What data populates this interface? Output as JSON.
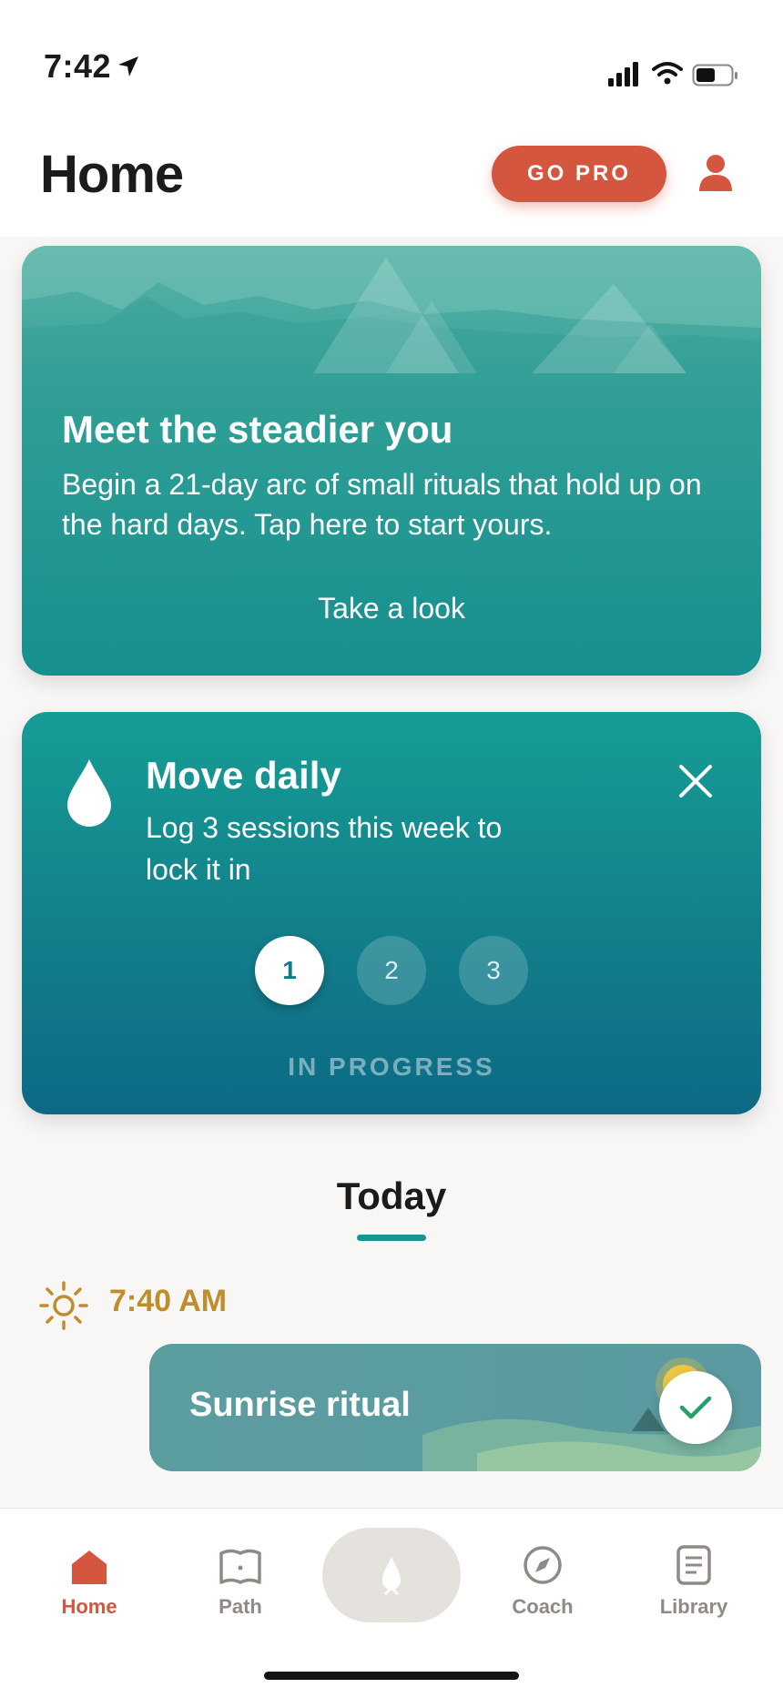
{
  "status_bar": {
    "time": "7:42"
  },
  "header": {
    "title": "Home",
    "go_pro_label": "GO PRO"
  },
  "hero": {
    "title": "Meet the steadier you",
    "body": "Begin a 21-day arc of small rituals that hold up on the hard days. Tap here to start yours.",
    "cta": "Take a look"
  },
  "goal": {
    "title": "Move daily",
    "body": "Log 3 sessions this week to lock it in",
    "steps": [
      "1",
      "2",
      "3"
    ],
    "completed_steps": 1,
    "status": "IN PROGRESS"
  },
  "today": {
    "heading": "Today",
    "slot_time": "7:40 AM",
    "ritual_label": "Sunrise ritual"
  },
  "tabs": {
    "home": "Home",
    "path": "Path",
    "coach": "Coach",
    "library": "Library"
  },
  "colors": {
    "accent": "#d4563e",
    "teal": "#16968f",
    "gold": "#c08d2c"
  }
}
